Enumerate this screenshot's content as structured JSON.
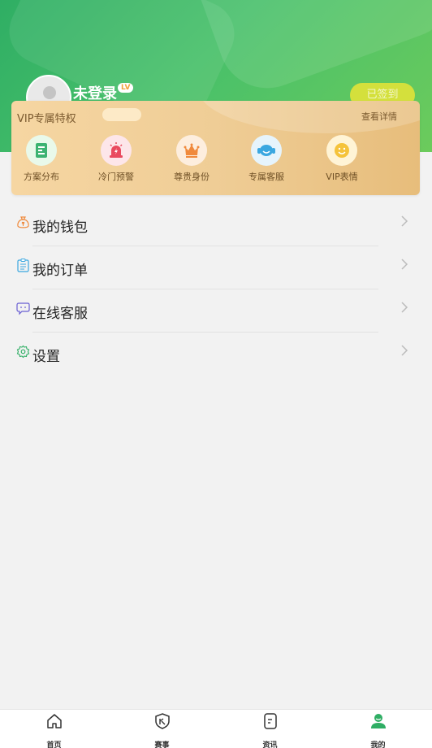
{
  "profile": {
    "username": "未登录",
    "level_badge": "LV",
    "sign_button": "已签到"
  },
  "vip": {
    "title": "VIP专属特权",
    "more_link": "查看详情",
    "items": [
      {
        "label": "方案分布",
        "icon": "plan-icon",
        "color": "#3cb371"
      },
      {
        "label": "冷门预警",
        "icon": "alarm-icon",
        "color": "#e94a5f"
      },
      {
        "label": "尊贵身份",
        "icon": "crown-icon",
        "color": "#f08a3c"
      },
      {
        "label": "专属客服",
        "icon": "headset-icon",
        "color": "#3aa7e0"
      },
      {
        "label": "VIP表情",
        "icon": "smiley-icon",
        "color": "#f5c33b"
      }
    ]
  },
  "menu": [
    {
      "label": "我的钱包",
      "icon": "wallet-icon"
    },
    {
      "label": "我的订单",
      "icon": "order-icon"
    },
    {
      "label": "在线客服",
      "icon": "service-icon"
    },
    {
      "label": "设置",
      "icon": "gear-icon"
    }
  ],
  "tabs": [
    {
      "label": "首页",
      "icon": "home-icon"
    },
    {
      "label": "赛事",
      "icon": "match-shield-icon"
    },
    {
      "label": "资讯",
      "icon": "news-icon"
    },
    {
      "label": "我的",
      "icon": "user-icon",
      "active": true
    }
  ],
  "colors": {
    "brand_green": "#2fae64",
    "vip_gold": "#efcd96",
    "sign_button": "#d4e03c"
  }
}
